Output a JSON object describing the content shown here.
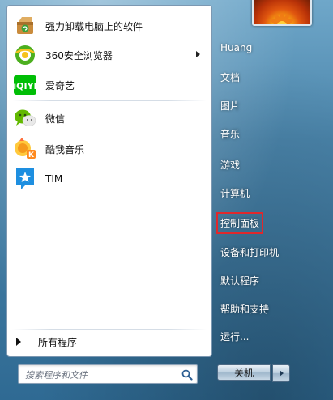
{
  "pinned_programs": [
    {
      "label": "强力卸载电脑上的软件",
      "icon": "uninstall-box-icon",
      "has_submenu": false
    },
    {
      "label": "360安全浏览器",
      "icon": "360-browser-icon",
      "has_submenu": true
    },
    {
      "label": "爱奇艺",
      "icon": "iqiyi-icon",
      "has_submenu": false
    }
  ],
  "recent_programs": [
    {
      "label": "微信",
      "icon": "wechat-icon",
      "has_submenu": false
    },
    {
      "label": "酷我音乐",
      "icon": "kuwo-music-icon",
      "has_submenu": false
    },
    {
      "label": "TIM",
      "icon": "tim-icon",
      "has_submenu": false
    }
  ],
  "all_programs_label": "所有程序",
  "search": {
    "placeholder": "搜索程序和文件"
  },
  "right_items": [
    {
      "label": "Huang"
    },
    {
      "label": "文档"
    },
    {
      "label": "图片"
    },
    {
      "label": "音乐"
    },
    {
      "label": "游戏"
    },
    {
      "label": "计算机"
    },
    {
      "label": "控制面板",
      "highlighted": true
    },
    {
      "label": "设备和打印机"
    },
    {
      "label": "默认程序"
    },
    {
      "label": "帮助和支持"
    },
    {
      "label": "运行..."
    }
  ],
  "shutdown": {
    "label": "关机"
  },
  "colors": {
    "highlight_box": "#e0282c",
    "iqiyi_green": "#00be06",
    "browser_green": "#4caf1f",
    "tim_blue": "#1e8fe0",
    "wechat_green": "#62b900"
  }
}
